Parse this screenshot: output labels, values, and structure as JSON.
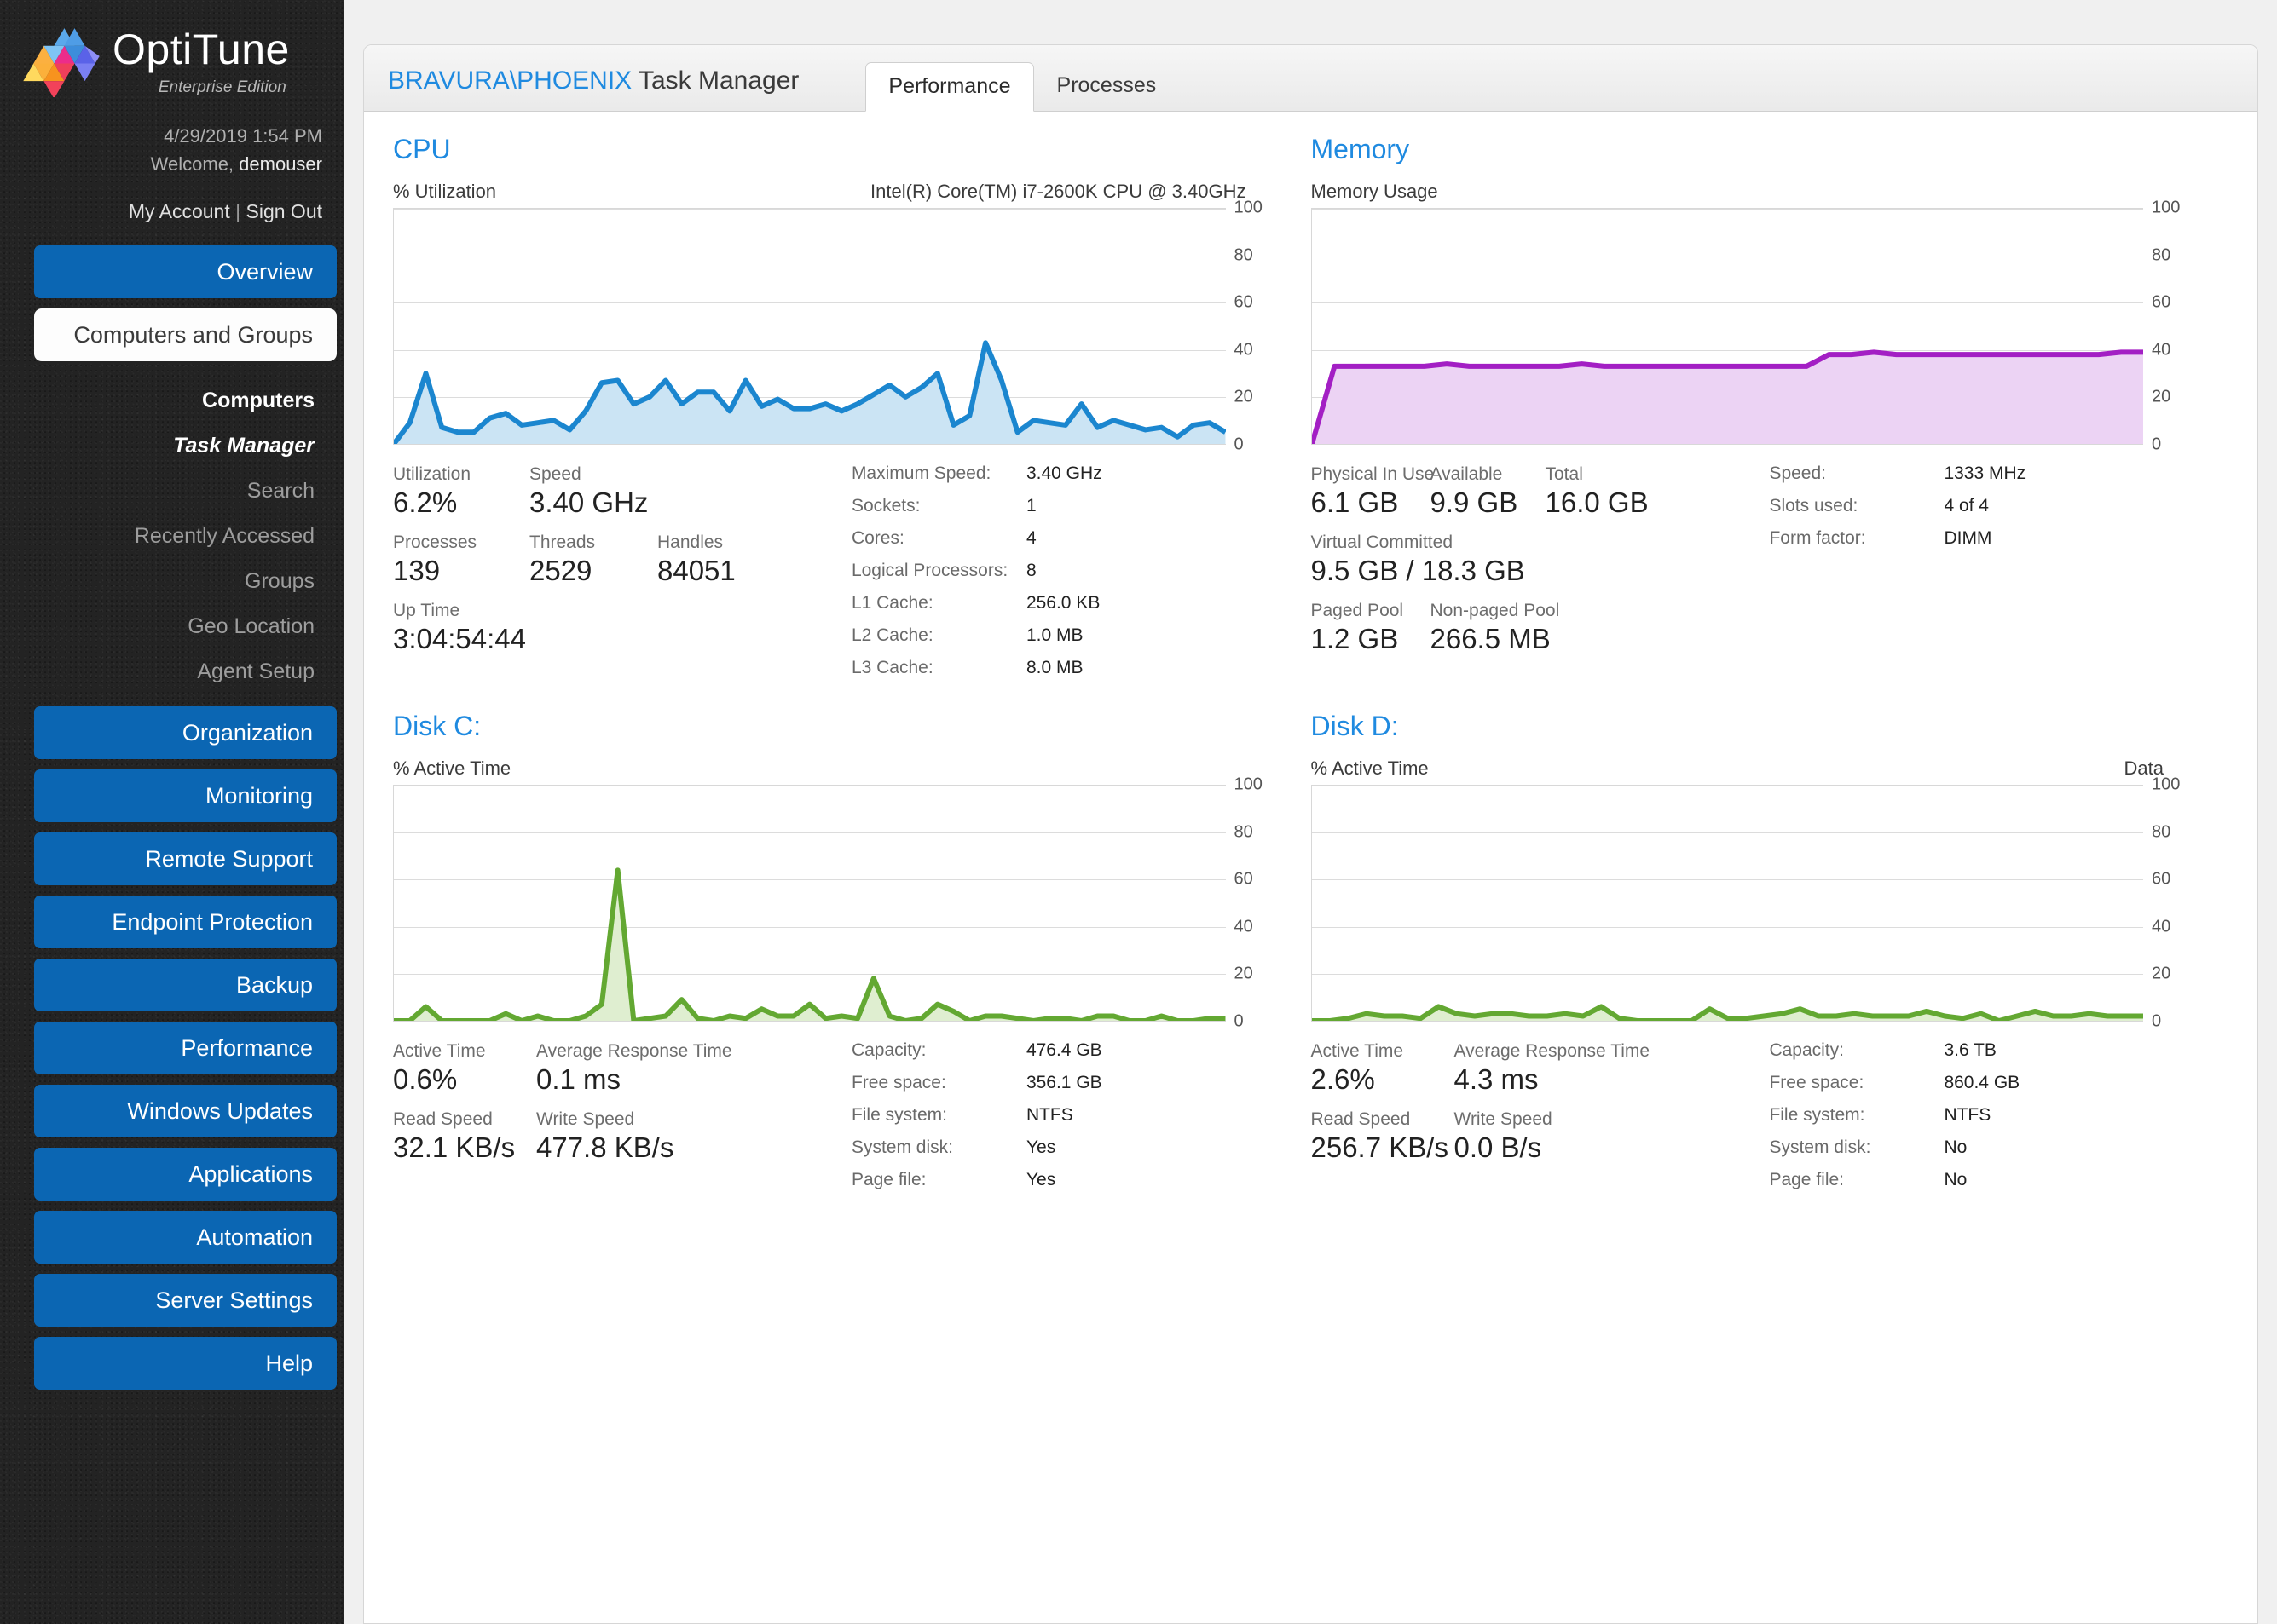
{
  "brand": {
    "name": "OptiTune",
    "edition": "Enterprise Edition"
  },
  "account": {
    "datetime": "4/29/2019 1:54 PM",
    "welcome_prefix": "Welcome, ",
    "username": "demouser",
    "my_account": "My Account",
    "separator": " | ",
    "sign_out": "Sign Out"
  },
  "sidebar": {
    "accent_color": "#0b66b3",
    "items": [
      {
        "label": "Overview",
        "style": "blue"
      },
      {
        "label": "Computers and Groups",
        "style": "white"
      }
    ],
    "subnav": [
      {
        "label": "Computers",
        "state": "head"
      },
      {
        "label": "Task Manager",
        "state": "active"
      },
      {
        "label": "Search",
        "state": "normal"
      },
      {
        "label": "Recently Accessed",
        "state": "normal"
      },
      {
        "label": "Groups",
        "state": "normal"
      },
      {
        "label": "Geo Location",
        "state": "normal"
      },
      {
        "label": "Agent Setup",
        "state": "normal"
      }
    ],
    "items2": [
      {
        "label": "Organization"
      },
      {
        "label": "Monitoring"
      },
      {
        "label": "Remote Support"
      },
      {
        "label": "Endpoint Protection"
      },
      {
        "label": "Backup"
      },
      {
        "label": "Performance"
      },
      {
        "label": "Windows Updates"
      },
      {
        "label": "Applications"
      },
      {
        "label": "Automation"
      },
      {
        "label": "Server Settings"
      },
      {
        "label": "Help"
      }
    ]
  },
  "header": {
    "host": "BRAVURA\\PHOENIX",
    "title": " Task Manager",
    "tabs": [
      {
        "label": "Performance",
        "active": true
      },
      {
        "label": "Processes",
        "active": false
      }
    ]
  },
  "cpu": {
    "section_title": "CPU",
    "chart_left_label": "% Utilization",
    "chart_right_label": "Intel(R) Core(TM) i7-2600K CPU @ 3.40GHz",
    "stats": [
      {
        "label": "Utilization",
        "value": "6.2%"
      },
      {
        "label": "Speed",
        "value": "3.40 GHz"
      },
      {
        "label": "Processes",
        "value": "139"
      },
      {
        "label": "Threads",
        "value": "2529"
      },
      {
        "label": "Handles",
        "value": "84051"
      },
      {
        "label": "Up Time",
        "value": "3:04:54:44"
      }
    ],
    "details": [
      {
        "key": "Maximum Speed:",
        "value": "3.40 GHz"
      },
      {
        "key": "Sockets:",
        "value": "1"
      },
      {
        "key": "Cores:",
        "value": "4"
      },
      {
        "key": "Logical Processors:",
        "value": "8"
      },
      {
        "key": "L1 Cache:",
        "value": "256.0 KB"
      },
      {
        "key": "L2 Cache:",
        "value": "1.0 MB"
      },
      {
        "key": "L3 Cache:",
        "value": "8.0 MB"
      }
    ]
  },
  "memory": {
    "section_title": "Memory",
    "chart_left_label": "Memory Usage",
    "chart_right_label": "",
    "stats": [
      {
        "label": "Physical In Use",
        "value": "6.1 GB"
      },
      {
        "label": "Available",
        "value": "9.9 GB"
      },
      {
        "label": "Total",
        "value": "16.0 GB"
      },
      {
        "label": "Virtual Committed",
        "value": "9.5 GB / 18.3 GB"
      },
      {
        "label": "Paged Pool",
        "value": "1.2 GB"
      },
      {
        "label": "Non-paged Pool",
        "value": "266.5 MB"
      }
    ],
    "details": [
      {
        "key": "Speed:",
        "value": "1333 MHz"
      },
      {
        "key": "Slots used:",
        "value": "4 of 4"
      },
      {
        "key": "Form factor:",
        "value": "DIMM"
      }
    ]
  },
  "disk_c": {
    "section_title": "Disk C:",
    "chart_left_label": "% Active Time",
    "chart_right_label": "",
    "stats": [
      {
        "label": "Active Time",
        "value": "0.6%"
      },
      {
        "label": "Average Response Time",
        "value": "0.1 ms"
      },
      {
        "label": "Read Speed",
        "value": "32.1 KB/s"
      },
      {
        "label": "Write Speed",
        "value": "477.8 KB/s"
      }
    ],
    "details": [
      {
        "key": "Capacity:",
        "value": "476.4 GB"
      },
      {
        "key": "Free space:",
        "value": "356.1 GB"
      },
      {
        "key": "File system:",
        "value": "NTFS"
      },
      {
        "key": "System disk:",
        "value": "Yes"
      },
      {
        "key": "Page file:",
        "value": "Yes"
      }
    ]
  },
  "disk_d": {
    "section_title": "Disk D:",
    "chart_left_label": "% Active Time",
    "chart_right_label": "Data",
    "stats": [
      {
        "label": "Active Time",
        "value": "2.6%"
      },
      {
        "label": "Average Response Time",
        "value": "4.3 ms"
      },
      {
        "label": "Read Speed",
        "value": "256.7 KB/s"
      },
      {
        "label": "Write Speed",
        "value": "0.0 B/s"
      }
    ],
    "details": [
      {
        "key": "Capacity:",
        "value": "3.6 TB"
      },
      {
        "key": "Free space:",
        "value": "860.4 GB"
      },
      {
        "key": "File system:",
        "value": "NTFS"
      },
      {
        "key": "System disk:",
        "value": "No"
      },
      {
        "key": "Page file:",
        "value": "No"
      }
    ]
  },
  "chart_data": [
    {
      "id": "cpu",
      "type": "area",
      "title": "% Utilization",
      "annotation": "Intel(R) Core(TM) i7-2600K CPU @ 3.40GHz",
      "ylabel": "% Utilization",
      "ylim": [
        0,
        100
      ],
      "yticks": [
        0,
        20,
        40,
        60,
        80,
        100
      ],
      "grid": true,
      "line_color": "#1b86cf",
      "fill_color": "#cbe4f4",
      "values": [
        0,
        9,
        30,
        7,
        5,
        5,
        11,
        13,
        8,
        9,
        10,
        6,
        14,
        26,
        27,
        17,
        20,
        27,
        17,
        22,
        22,
        14,
        27,
        16,
        19,
        15,
        15,
        17,
        14,
        17,
        21,
        25,
        20,
        24,
        30,
        8,
        12,
        43,
        27,
        5,
        10,
        9,
        8,
        17,
        7,
        10,
        8,
        6,
        7,
        3,
        8,
        9,
        5
      ]
    },
    {
      "id": "memory",
      "type": "area",
      "title": "Memory Usage",
      "ylabel": "Memory Usage",
      "ylim": [
        0,
        100
      ],
      "yticks": [
        0,
        20,
        40,
        60,
        80,
        100
      ],
      "grid": true,
      "line_color": "#a31fc4",
      "fill_color": "#ecd3f4",
      "values": [
        0,
        33,
        33,
        33,
        33,
        33,
        34,
        33,
        33,
        33,
        33,
        33,
        34,
        33,
        33,
        33,
        33,
        33,
        33,
        33,
        33,
        33,
        33,
        38,
        38,
        39,
        38,
        38,
        38,
        38,
        38,
        38,
        38,
        38,
        38,
        38,
        39,
        39
      ]
    },
    {
      "id": "disk_c",
      "type": "area",
      "title": "% Active Time",
      "ylabel": "% Active Time",
      "ylim": [
        0,
        100
      ],
      "yticks": [
        0,
        20,
        40,
        60,
        80,
        100
      ],
      "grid": true,
      "line_color": "#63a832",
      "fill_color": "#dfeed0",
      "values": [
        0,
        0,
        6,
        0,
        0,
        0,
        0,
        3,
        0,
        2,
        0,
        0,
        2,
        7,
        64,
        0,
        1,
        2,
        9,
        1,
        0,
        2,
        1,
        5,
        2,
        2,
        7,
        1,
        2,
        1,
        18,
        2,
        0,
        1,
        7,
        4,
        0,
        2,
        2,
        1,
        0,
        1,
        1,
        0,
        2,
        2,
        0,
        0,
        2,
        0,
        0,
        1,
        1
      ]
    },
    {
      "id": "disk_d",
      "type": "area",
      "title": "% Active Time",
      "annotation": "Data",
      "ylabel": "% Active Time",
      "ylim": [
        0,
        100
      ],
      "yticks": [
        0,
        20,
        40,
        60,
        80,
        100
      ],
      "grid": true,
      "line_color": "#63a832",
      "fill_color": "#dfeed0",
      "values": [
        0,
        0,
        1,
        3,
        2,
        2,
        1,
        6,
        3,
        2,
        3,
        3,
        2,
        2,
        3,
        2,
        6,
        1,
        0,
        0,
        0,
        0,
        5,
        1,
        1,
        2,
        3,
        5,
        2,
        2,
        3,
        2,
        2,
        2,
        4,
        2,
        1,
        3,
        0,
        2,
        4,
        2,
        2,
        3,
        2,
        2,
        2
      ]
    }
  ]
}
